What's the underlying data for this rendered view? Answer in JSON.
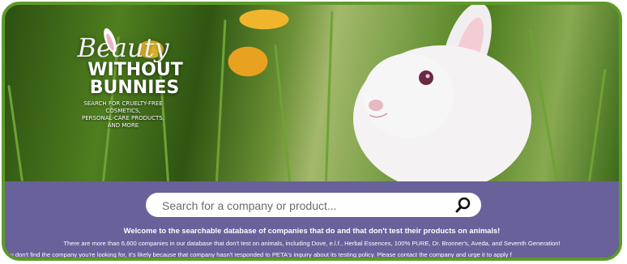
{
  "brand": {
    "beauty": "Beauty",
    "without": "WITHOUT",
    "bunnies": "BUNNIES",
    "tagline_1": "SEARCH FOR CRUELTY-FREE",
    "tagline_2": "COSMETICS,",
    "tagline_3": "PERSONAL-CARE PRODUCTS,",
    "tagline_4": "AND MORE"
  },
  "search": {
    "placeholder": "Search for a company or product...",
    "value": "",
    "icon": "magnifier-icon"
  },
  "info": {
    "welcome": "Welcome to the searchable database of companies that do and that don't test their products on animals!",
    "line1": "There are more than 6,600 companies in our database that don't test on animals, including Dove, e.l.f., Herbal Essences, 100% PURE, Dr. Bronner's, Aveda, and Seventh Generation!",
    "line2": "You don't find the company you're looking for, it's likely because that company hasn't responded to PETA's inquiry about its testing policy. Please contact the company and urge it to apply f"
  },
  "colors": {
    "frame": "#5e9a2a",
    "panel": "#68619a",
    "text": "#ffffff"
  }
}
